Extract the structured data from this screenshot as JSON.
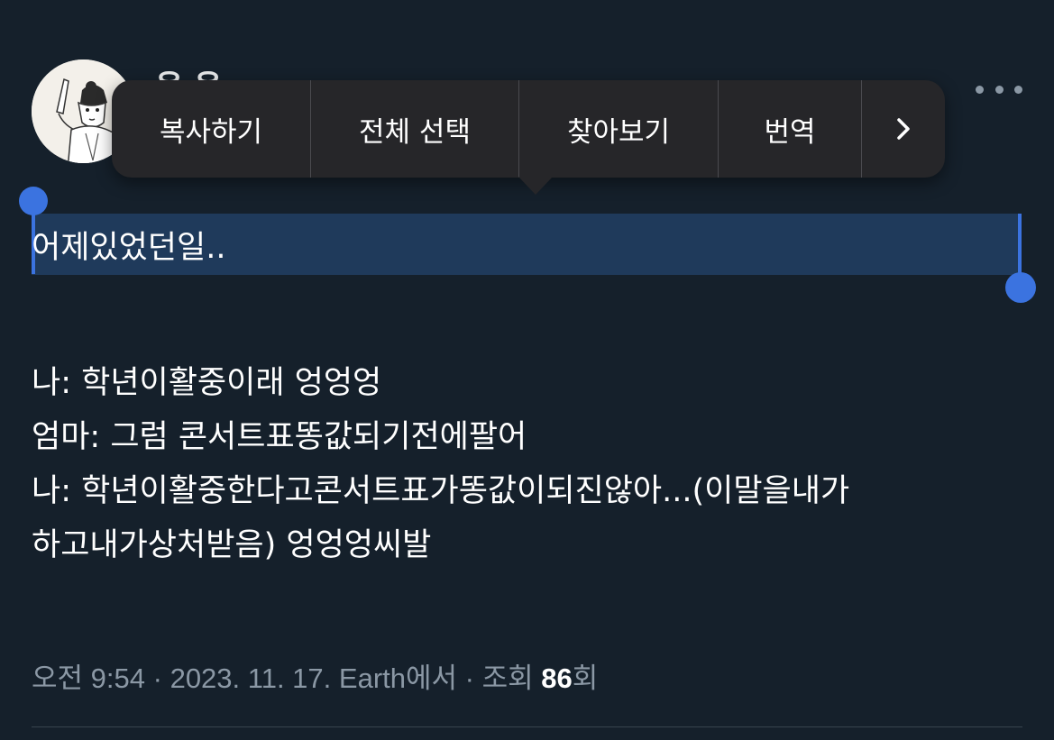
{
  "author": {
    "name_peek": "윤 윤"
  },
  "context_menu": {
    "items": [
      "복사하기",
      "전체 선택",
      "찾아보기",
      "번역"
    ],
    "more_icon": "chevron-right-icon"
  },
  "tweet": {
    "selected_line": "어제있었던일..",
    "lines": [
      "나: 학년이활중이래 엉엉엉",
      "엄마: 그럼 콘서트표똥값되기전에팔어",
      "나: 학년이활중한다고콘서트표가똥값이되진않아...(이말을내가",
      "하고내가상처받음) 엉엉엉씨발"
    ]
  },
  "meta": {
    "time": "오전 9:54",
    "date": "2023. 11. 17.",
    "source": "Earth에서",
    "views_label_pre": "조회",
    "views_count": "86",
    "views_label_post": "회",
    "separator": "·"
  },
  "colors": {
    "background": "#15202b",
    "selection": "#1f3a5b",
    "handle": "#3b73e0",
    "menu_bg": "#262629",
    "muted_text": "#8b98a5"
  }
}
